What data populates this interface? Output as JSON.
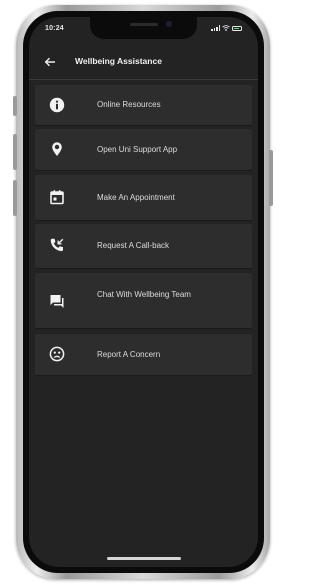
{
  "status_bar": {
    "time": "10:24",
    "icons": [
      "signal-icon",
      "wifi-icon",
      "battery-icon"
    ]
  },
  "header": {
    "title": "Wellbeing Assistance",
    "back_icon": "back-arrow-icon"
  },
  "menu": {
    "items": [
      {
        "label": "Online Resources",
        "icon": "info-icon"
      },
      {
        "label": "Open Uni Support App",
        "icon": "location-pin-icon"
      },
      {
        "label": "Make An Appointment",
        "icon": "calendar-icon"
      },
      {
        "label": "Request A Call-back",
        "icon": "phone-callback-icon"
      },
      {
        "label": "Chat With Wellbeing Team",
        "icon": "chat-icon"
      },
      {
        "label": "Report A Concern",
        "icon": "concern-face-icon"
      }
    ]
  },
  "colors": {
    "screen_background": "#232323",
    "card_background": "#2d2d2d",
    "text": "#dcdcdc",
    "icon": "#f2f2f2"
  }
}
